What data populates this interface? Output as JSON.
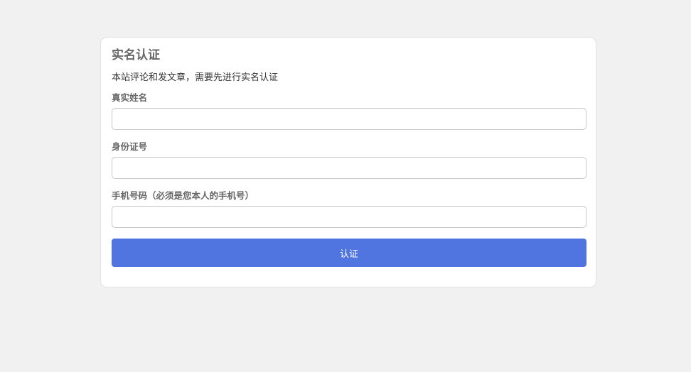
{
  "form": {
    "title": "实名认证",
    "description": "本站评论和发文章，需要先进行实名认证",
    "fields": [
      {
        "label": "真实姓名",
        "value": "",
        "placeholder": ""
      },
      {
        "label": "身份证号",
        "value": "",
        "placeholder": ""
      },
      {
        "label": "手机号码（必须是您本人的手机号）",
        "value": "",
        "placeholder": ""
      }
    ],
    "submit_label": "认证"
  },
  "colors": {
    "page_background": "#f1f1f1",
    "card_background": "#ffffff",
    "submit_button": "#5175e0"
  }
}
